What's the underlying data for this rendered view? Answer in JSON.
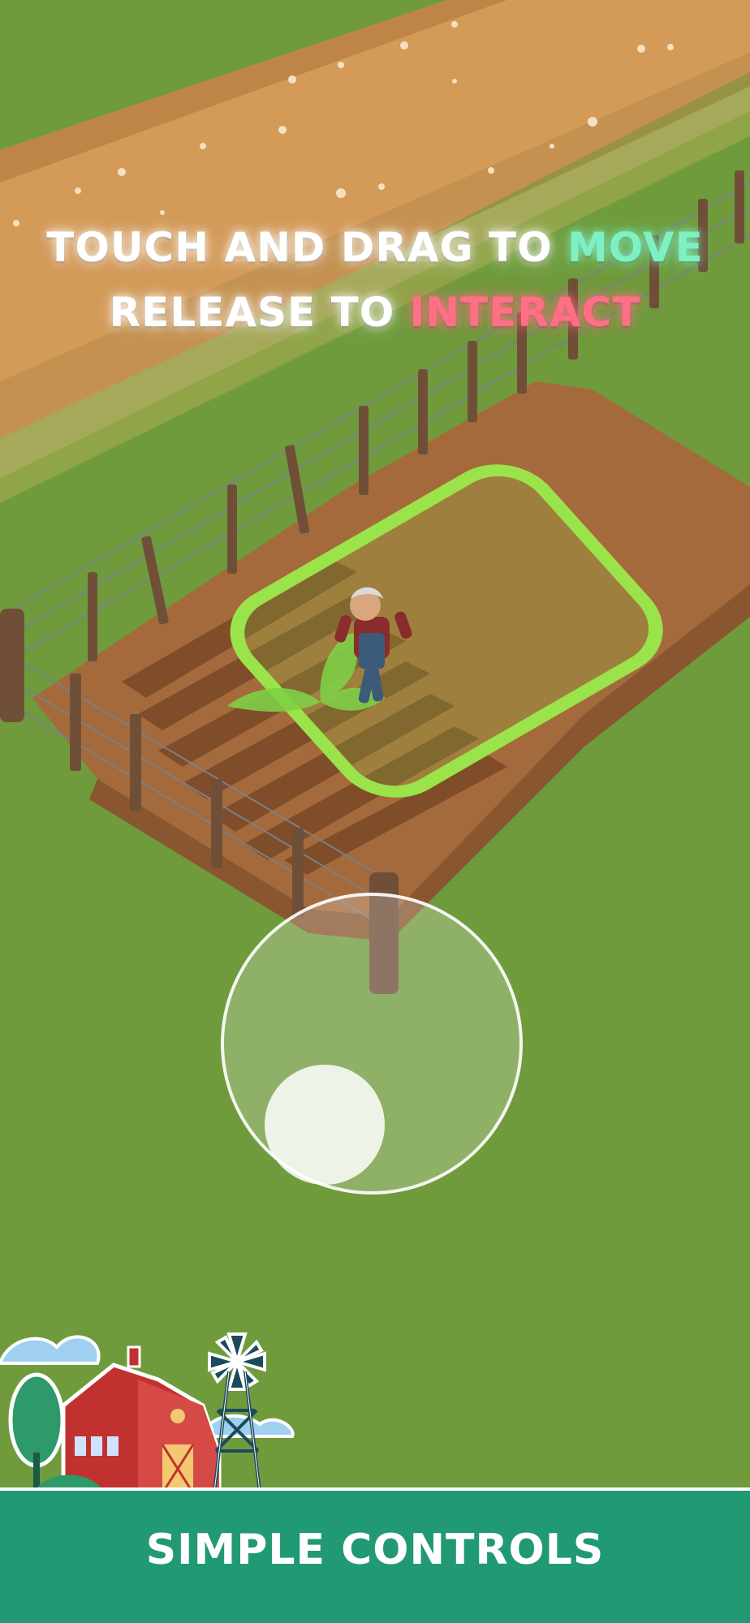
{
  "instructions": {
    "line1_prefix": "TOUCH AND DRAG TO ",
    "line1_highlight": "MOVE",
    "line2_prefix": "RELEASE TO ",
    "line2_highlight": "INTERACT"
  },
  "banner": {
    "label": "SIMPLE CONTROLS"
  },
  "colors": {
    "grass": "#6f9b3d",
    "road": "#d39a58",
    "soil": "#9c6437",
    "move_highlight": "#7ef0c2",
    "interact_highlight": "#ff6f86",
    "banner": "#219974",
    "barn": "#c0312f"
  },
  "icons": [
    "seedling-icon",
    "barn-icon",
    "windmill-icon",
    "tree-icon",
    "cloud-icon"
  ]
}
